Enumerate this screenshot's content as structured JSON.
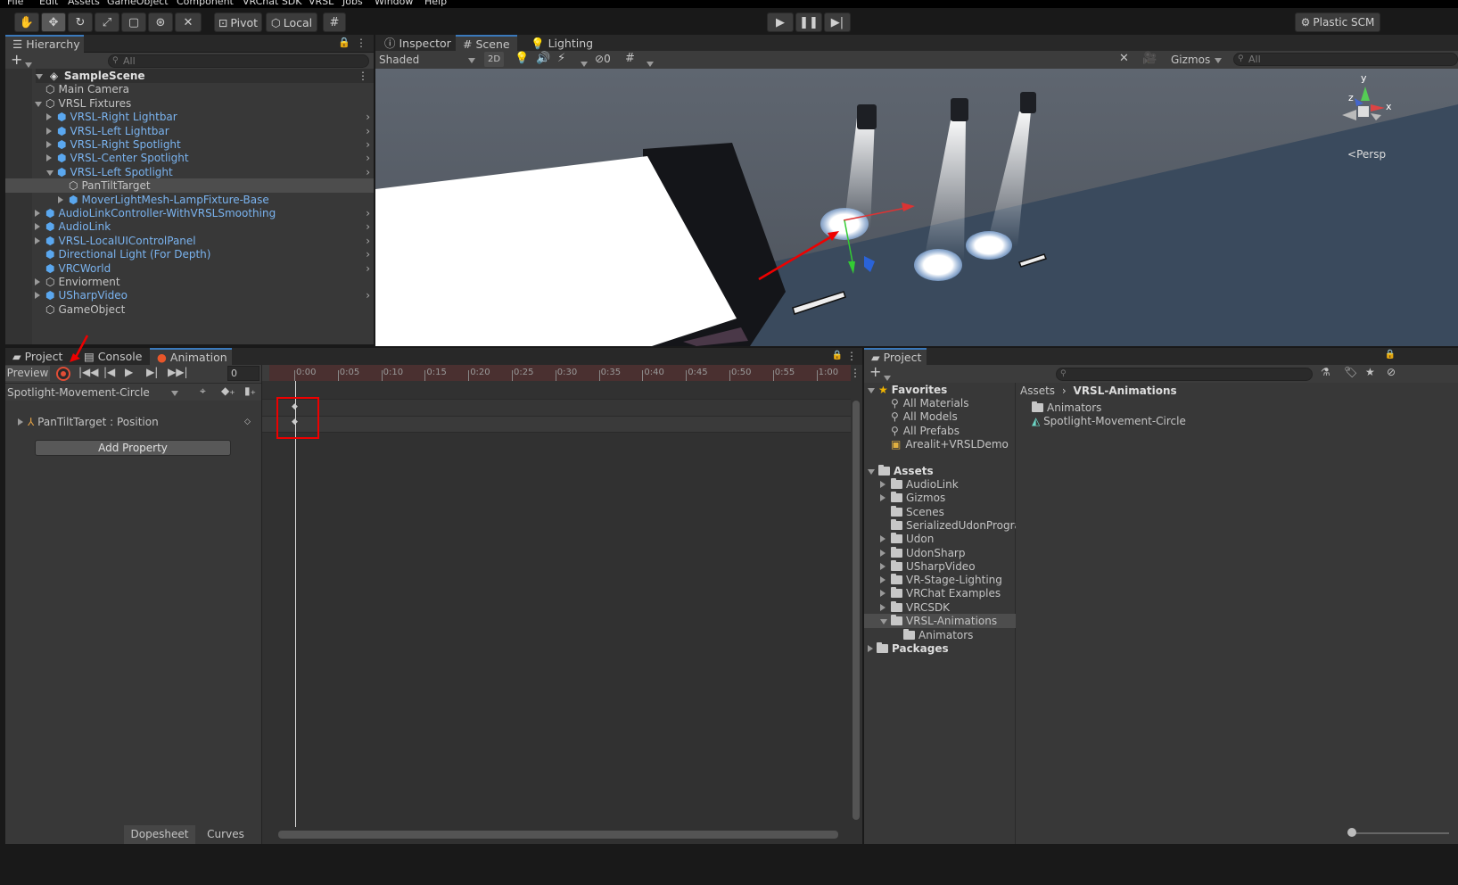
{
  "menubar": [
    "File",
    "Edit",
    "Assets",
    "GameObject",
    "Component",
    "VRChat SDK",
    "VRSL",
    "Jobs",
    "Window",
    "Help"
  ],
  "toolbar": {
    "pivot": "Pivot",
    "local": "Local",
    "plastic": "Plastic SCM"
  },
  "hierarchy": {
    "tab": "Hierarchy",
    "search_placeholder": "All",
    "scene": "SampleScene",
    "items": [
      {
        "label": "Main Camera",
        "depth": 1,
        "blue": false,
        "expand": "none",
        "more": false
      },
      {
        "label": "VRSL Fixtures",
        "depth": 1,
        "blue": false,
        "expand": "open",
        "more": false
      },
      {
        "label": "VRSL-Right Lightbar",
        "depth": 2,
        "blue": true,
        "expand": "closed",
        "more": true
      },
      {
        "label": "VRSL-Left Lightbar",
        "depth": 2,
        "blue": true,
        "expand": "closed",
        "more": true
      },
      {
        "label": "VRSL-Right Spotlight",
        "depth": 2,
        "blue": true,
        "expand": "closed",
        "more": true
      },
      {
        "label": "VRSL-Center Spotlight",
        "depth": 2,
        "blue": true,
        "expand": "closed",
        "more": true
      },
      {
        "label": "VRSL-Left Spotlight",
        "depth": 2,
        "blue": true,
        "expand": "open",
        "more": true
      },
      {
        "label": "PanTiltTarget",
        "depth": 3,
        "blue": false,
        "expand": "none",
        "more": false,
        "selected": true
      },
      {
        "label": "MoverLightMesh-LampFixture-Base",
        "depth": 3,
        "blue": true,
        "expand": "closed",
        "more": false
      },
      {
        "label": "AudioLinkController-WithVRSLSmoothing",
        "depth": 1,
        "blue": true,
        "expand": "closed",
        "more": true
      },
      {
        "label": "AudioLink",
        "depth": 1,
        "blue": true,
        "expand": "closed",
        "more": true
      },
      {
        "label": "VRSL-LocalUIControlPanel",
        "depth": 1,
        "blue": true,
        "expand": "closed",
        "more": true
      },
      {
        "label": "Directional Light (For Depth)",
        "depth": 1,
        "blue": true,
        "expand": "none",
        "more": true
      },
      {
        "label": "VRCWorld",
        "depth": 1,
        "blue": true,
        "expand": "none",
        "more": true
      },
      {
        "label": "Enviorment",
        "depth": 1,
        "blue": false,
        "expand": "closed",
        "more": false
      },
      {
        "label": "USharpVideo",
        "depth": 1,
        "blue": true,
        "expand": "closed",
        "more": true
      },
      {
        "label": "GameObject",
        "depth": 1,
        "blue": false,
        "expand": "none",
        "more": false
      }
    ]
  },
  "sceneview": {
    "tabs": [
      "Inspector",
      "Scene",
      "Lighting"
    ],
    "shading": "Shaded",
    "mode2d": "2D",
    "hidden_count": "0",
    "gizmos": "Gizmos",
    "search_placeholder": "All",
    "persp": "Persp",
    "axis_x": "x",
    "axis_y": "y",
    "axis_z": "z"
  },
  "animation": {
    "tabs": [
      "Project",
      "Console",
      "Animation"
    ],
    "preview": "Preview",
    "frame": "0",
    "clip": "Spotlight-Movement-Circle",
    "property": "PanTiltTarget : Position",
    "add_property": "Add Property",
    "ticks": [
      "0:00",
      "0:05",
      "0:10",
      "0:15",
      "0:20",
      "0:25",
      "0:30",
      "0:35",
      "0:40",
      "0:45",
      "0:50",
      "0:55",
      "1:00"
    ],
    "dopesheet": "Dopesheet",
    "curves": "Curves"
  },
  "project": {
    "tab": "Project",
    "favorites_label": "Favorites",
    "favorites": [
      "All Materials",
      "All Models",
      "All Prefabs",
      "Arealit+VRSLDemo"
    ],
    "assets_label": "Assets",
    "assets": [
      {
        "label": "AudioLink",
        "expand": true
      },
      {
        "label": "Gizmos",
        "expand": true
      },
      {
        "label": "Scenes",
        "expand": false
      },
      {
        "label": "SerializedUdonProgran",
        "expand": false
      },
      {
        "label": "Udon",
        "expand": true
      },
      {
        "label": "UdonSharp",
        "expand": true
      },
      {
        "label": "USharpVideo",
        "expand": true
      },
      {
        "label": "VR-Stage-Lighting",
        "expand": true
      },
      {
        "label": "VRChat Examples",
        "expand": true
      },
      {
        "label": "VRCSDK",
        "expand": true
      },
      {
        "label": "VRSL-Animations",
        "expand": true,
        "open": true,
        "selected": true
      }
    ],
    "sub_animators": "Animators",
    "packages_label": "Packages",
    "breadcrumb_root": "Assets",
    "breadcrumb_current": "VRSL-Animations",
    "contents": [
      "Animators",
      "Spotlight-Movement-Circle"
    ]
  }
}
